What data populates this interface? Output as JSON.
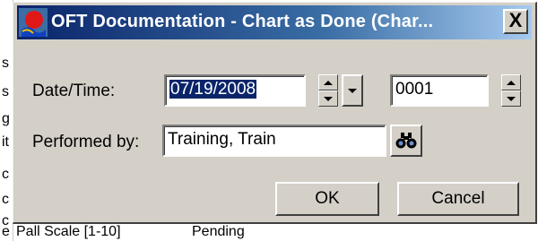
{
  "dialog": {
    "title": "OFT Documentation - Chart as Done (Char...",
    "close_glyph": "X"
  },
  "form": {
    "datetime_label": "Date/Time:",
    "date_value": "07/19/2008",
    "time_value": "0001",
    "performed_by_label": "Performed by:",
    "performed_by_value": "Training, Train"
  },
  "buttons": {
    "ok": "OK",
    "cancel": "Cancel"
  },
  "background": {
    "left_letters": [
      "s",
      "s",
      "g",
      "it",
      "c",
      "c",
      "c"
    ],
    "bottom_row": [
      "e",
      "Pall Scale [1-10]",
      "Pending"
    ]
  },
  "colors": {
    "title_start": "#0a246a",
    "title_end": "#a6caf0",
    "dialog_face": "#d4d0c8",
    "selection": "#0a246a"
  }
}
